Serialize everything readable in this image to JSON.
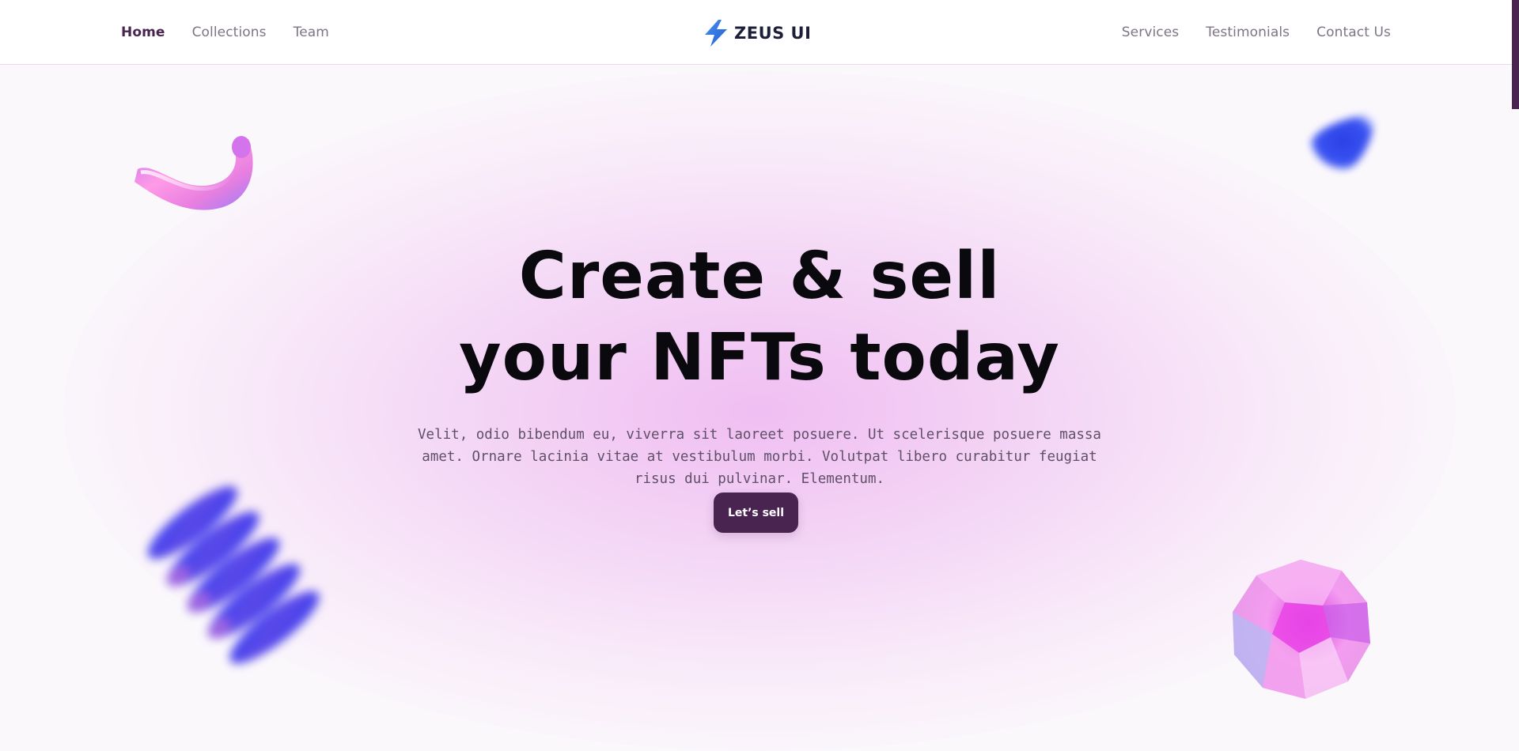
{
  "header": {
    "nav_left": [
      {
        "label": "Home",
        "active": true
      },
      {
        "label": "Collections",
        "active": false
      },
      {
        "label": "Team",
        "active": false
      }
    ],
    "logo_text": "ZEUS UI",
    "logo_icon": "lightning-bolt-icon",
    "nav_right": [
      {
        "label": "Services"
      },
      {
        "label": "Testimonials"
      },
      {
        "label": "Contact Us"
      }
    ]
  },
  "hero": {
    "headline_line1": "Create & sell",
    "headline_line2": "your NFTs today",
    "subtext": "Velit, odio bibendum eu, viverra sit laoreet posuere. Ut scelerisque posuere massa amet. Ornare lacinia vitae at vestibulum morbi. Volutpat libero curabitur feugiat risus dui pulvinar. Elementum.",
    "cta_label": "Let’s sell"
  },
  "decorations": [
    {
      "name": "torus-shape-icon"
    },
    {
      "name": "cone-shape-icon"
    },
    {
      "name": "spiral-shape-icon"
    },
    {
      "name": "gem-shape-icon"
    }
  ],
  "colors": {
    "accent": "#4a2450",
    "logo_blue": "#2f6fe0",
    "nav_text": "#7d7485",
    "headline": "#0a0a0e",
    "glow": "#eeb4f0"
  }
}
